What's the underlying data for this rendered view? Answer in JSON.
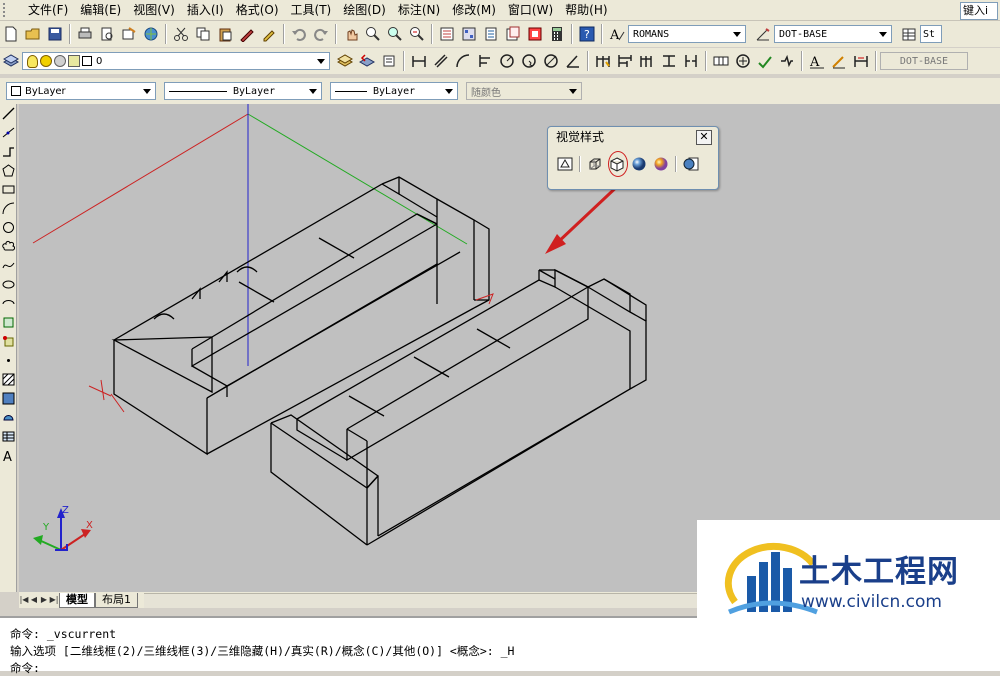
{
  "menu": {
    "items": [
      "文件(F)",
      "编辑(E)",
      "视图(V)",
      "插入(I)",
      "格式(O)",
      "工具(T)",
      "绘图(D)",
      "标注(N)",
      "修改(M)",
      "窗口(W)",
      "帮助(H)"
    ],
    "search_hint": "键入i"
  },
  "toolbar1": {
    "text_style": "ROMANS",
    "dim_style": "DOT-BASE",
    "table_style": "St"
  },
  "toolbar2": {
    "layer_value": "0",
    "dim_style_right": "DOT-BASE"
  },
  "properties": {
    "color": "ByLayer",
    "linetype": "ByLayer",
    "lineweight": "ByLayer",
    "plot_style": "随颜色"
  },
  "visual_styles_panel": {
    "title": "视觉样式",
    "close_label": "✕",
    "buttons": [
      "2d-wireframe",
      "3d-wireframe",
      "3d-hidden",
      "realistic",
      "conceptual",
      "visual-styles-manager"
    ],
    "highlighted": "3d-hidden",
    "annotation_color": "#d02020"
  },
  "ucs": {
    "x_label": "X",
    "y_label": "Y",
    "z_label": "Z"
  },
  "tabs": {
    "model": "模型",
    "layout1": "布局1"
  },
  "command": {
    "line1": "命令:  _vscurrent",
    "line2": "输入选项 [二维线框(2)/三维线框(3)/三维隐藏(H)/真实(R)/概念(C)/其他(O)] <概念>: _H",
    "line3": "命令:"
  },
  "watermark": {
    "name": "土木工程网",
    "url": "www.civilcn.com"
  },
  "colors": {
    "ui_face": "#ece9d8",
    "canvas": "#c0c0c0",
    "x_axis": "#cc2222",
    "y_axis": "#22aa22",
    "z_axis": "#2222cc",
    "brand": "#1a3f8a"
  }
}
